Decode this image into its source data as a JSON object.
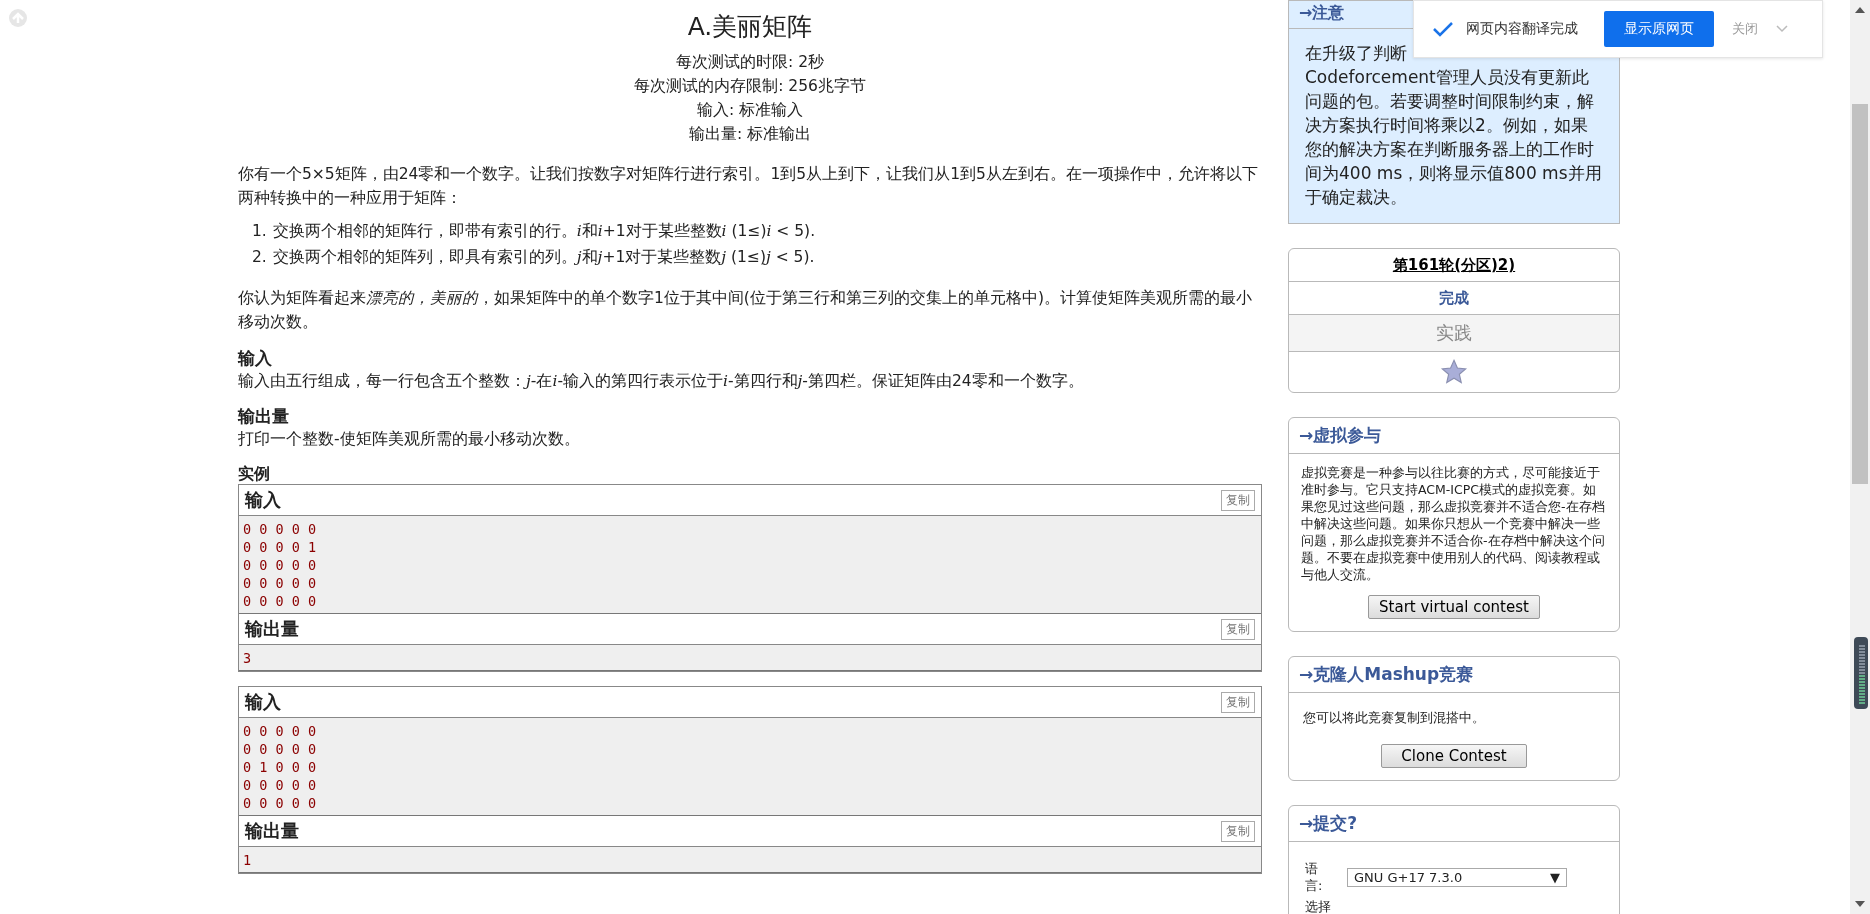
{
  "problem": {
    "title": "A.美丽矩阵",
    "limits": [
      "每次测试的时限: 2秒",
      "每次测试的内存限制: 256兆字节",
      "输入: 标准输入",
      "输出量: 标准输出"
    ],
    "statement": "你有一个5×5矩阵，由24零和一个数字。让我们按数字对矩阵行进行索引。1到5从上到下，让我们从1到5从左到右。在一项操作中，允许将以下两种转换中的一种应用于矩阵：",
    "operations": [
      {
        "number": "1.",
        "parts": [
          {
            "text": "交换两个相邻的矩阵行，即带有索引的行。",
            "italic": false
          },
          {
            "text": "i",
            "italic": true
          },
          {
            "text": "和",
            "italic": false
          },
          {
            "text": "i",
            "italic": true
          },
          {
            "text": "+1对于某些整数",
            "italic": false
          },
          {
            "text": "i",
            "italic": true
          },
          {
            "text": " (1≤)",
            "italic": false
          },
          {
            "text": "i",
            "italic": true
          },
          {
            "text": " < 5).",
            "italic": false
          }
        ]
      },
      {
        "number": "2.",
        "parts": [
          {
            "text": "交换两个相邻的矩阵列，即具有索引的列。",
            "italic": false
          },
          {
            "text": "j",
            "italic": true
          },
          {
            "text": "和",
            "italic": false
          },
          {
            "text": "j",
            "italic": true
          },
          {
            "text": "+1对于某些整数",
            "italic": false
          },
          {
            "text": "j",
            "italic": true
          },
          {
            "text": " (1≤)",
            "italic": false
          },
          {
            "text": "j",
            "italic": true
          },
          {
            "text": " < 5).",
            "italic": false
          }
        ]
      }
    ],
    "definition": [
      {
        "text": "你认为矩阵看起来",
        "italic": false
      },
      {
        "text": "漂亮的，美丽的",
        "italic": true
      },
      {
        "text": "，如果矩阵中的单个数字1位于其中间(位于第三行和第三列的交集上的单元格中)。计算使矩阵美观所需的最小移动次数。",
        "italic": false
      }
    ],
    "sections": [
      {
        "title": "输入",
        "parts": [
          {
            "text": "输入由五行组成，每一行包含五个整数：",
            "italic": false
          },
          {
            "text": "j",
            "italic": true
          },
          {
            "text": "-在",
            "italic": false
          },
          {
            "text": "i",
            "italic": true
          },
          {
            "text": "-输入的第四行表示位于",
            "italic": false
          },
          {
            "text": "i",
            "italic": true
          },
          {
            "text": "-第四行和",
            "italic": false
          },
          {
            "text": "j",
            "italic": true
          },
          {
            "text": "-第四栏。保证矩阵由24零和一个数字。",
            "italic": false
          }
        ]
      },
      {
        "title": "输出量",
        "parts": [
          {
            "text": "打印一个整数-使矩阵美观所需的最小移动次数。",
            "italic": false
          }
        ]
      }
    ],
    "examples_title": "实例",
    "examples": [
      {
        "input_title": "输入",
        "input": [
          "0 0 0 0 0",
          "0 0 0 0 1",
          "0 0 0 0 0",
          "0 0 0 0 0",
          "0 0 0 0 0"
        ],
        "output_title": "输出量",
        "output": [
          "3"
        ],
        "input_copy": "复制",
        "output_copy": "复制"
      },
      {
        "input_title": "输入",
        "input": [
          "0 0 0 0 0",
          "0 0 0 0 0",
          "0 1 0 0 0",
          "0 0 0 0 0",
          "0 0 0 0 0"
        ],
        "output_title": "输出量",
        "output": [
          "1"
        ],
        "input_copy": "复制",
        "output_copy": "复制"
      }
    ]
  },
  "sidebar": {
    "notice": {
      "title": "→注意",
      "first_line": "在升级了判断",
      "text": "Codeforcement管理人员没有更新此问题的包。若要调整时间限制约束，解决方案执行时间将乘以2。例如，如果您的解决方案在判断服务器上的工作时间为400 ms，则将显示值800 ms并用于确定裁决。"
    },
    "contest": {
      "name": "第161轮(分区)2)",
      "status": "完成",
      "phase": "实践"
    },
    "virtual": {
      "title": "→虚拟参与",
      "text": "虚拟竞赛是一种参与以往比赛的方式，尽可能接近于准时参与。它只支持ACM-ICPC模式的虚拟竞赛。如果您见过这些问题，那么虚拟竞赛并不适合您-在存档中解决这些问题。如果你只想从一个竞赛中解决一些问题，那么虚拟竞赛并不适合你-在存档中解决这个问题。不要在虚拟竞赛中使用别人的代码、阅读教程或与他人交流。",
      "button": "Start virtual contest"
    },
    "mashup": {
      "title": "→克隆人Mashup竞赛",
      "text": "您可以将此竞赛复制到混搭中。",
      "button": "Clone Contest"
    },
    "submit": {
      "title": "→提交?",
      "language_label": "语言:",
      "language": "GNU G+17 7.3.0",
      "dropdown_arrow": "▼",
      "file_label": "选择"
    }
  },
  "translate_bar": {
    "message": "网页内容翻译完成",
    "show_original": "显示原网页",
    "close": "关闭"
  }
}
